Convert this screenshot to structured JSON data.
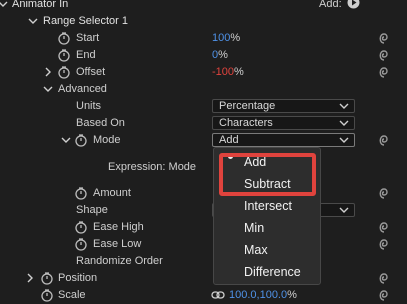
{
  "header": {
    "animator_label": "Animator In",
    "add_label": "Add:"
  },
  "range_selector": {
    "label": "Range Selector 1"
  },
  "properties": {
    "start": {
      "label": "Start",
      "value": "100",
      "unit": "%"
    },
    "end": {
      "label": "End",
      "value": "0",
      "unit": "%"
    },
    "offset": {
      "label": "Offset",
      "value": "-100",
      "unit": "%"
    }
  },
  "advanced": {
    "label": "Advanced",
    "units": {
      "label": "Units",
      "value": "Percentage"
    },
    "based_on": {
      "label": "Based On",
      "value": "Characters"
    },
    "mode": {
      "label": "Mode",
      "value": "Add"
    },
    "expression_mode": {
      "label": "Expression: Mode"
    },
    "amount": {
      "label": "Amount"
    },
    "shape": {
      "label": "Shape"
    },
    "ease_high": {
      "label": "Ease High"
    },
    "ease_low": {
      "label": "Ease Low"
    },
    "randomize_order": {
      "label": "Randomize Order"
    }
  },
  "position": {
    "label": "Position"
  },
  "scale": {
    "label": "Scale",
    "value": "100.0,100.0",
    "unit": "%"
  },
  "mode_menu": {
    "selected": "Add",
    "items": [
      "Add",
      "Subtract",
      "Intersect",
      "Min",
      "Max",
      "Difference"
    ]
  },
  "colors": {
    "value_blue": "#4f92e8",
    "value_red": "#e0433d",
    "highlight": "#e0433d",
    "background": "#1e1e1e"
  }
}
